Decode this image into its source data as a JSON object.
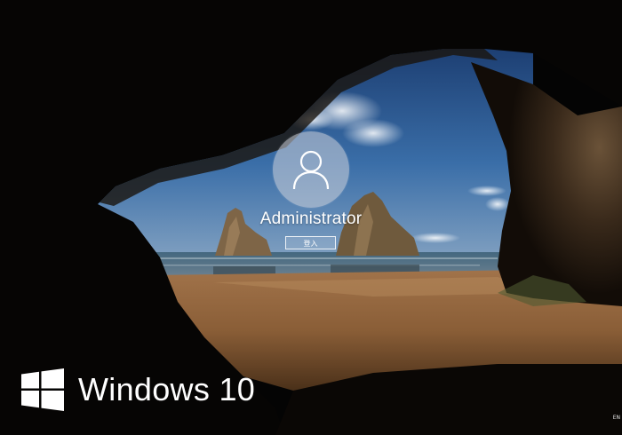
{
  "login": {
    "user_name": "Administrator",
    "signin_label": "登入"
  },
  "branding": {
    "product_name": "Windows 10",
    "logo_icon": "windows-logo-icon"
  },
  "status": {
    "language": "EN"
  },
  "background": {
    "scene": "cave-beach-wallpaper"
  },
  "colors": {
    "sky": "#2f5f9a",
    "sand": "#b07a45",
    "cave": "#2b2016",
    "text": "#ffffff"
  }
}
